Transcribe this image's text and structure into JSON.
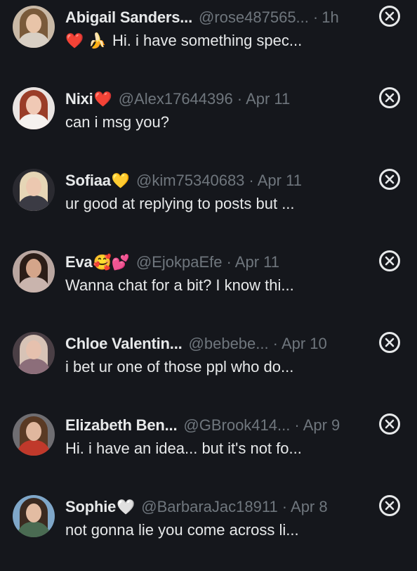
{
  "dismiss_icon": "close-circle-icon",
  "colors": {
    "background": "#15171c",
    "primary_text": "#e7e9ea",
    "secondary_text": "#6f767d"
  },
  "messages": [
    {
      "name": "Abigail Sanders...",
      "name_emoji": "",
      "handle": "@rose487565...",
      "separator": "·",
      "time": "1h",
      "lead_emoji": "❤️ 🍌",
      "preview": "Hi. i have something spec...",
      "avatar_colors": {
        "bg": "#c9b9a6",
        "hair": "#7a5a3a",
        "face": "#e8c4a8",
        "body": "#d8cfc4"
      }
    },
    {
      "name": "Nixi",
      "name_emoji": "❤️",
      "handle": "@Alex17644396",
      "separator": "·",
      "time": "Apr 11",
      "lead_emoji": "",
      "preview": "can i msg you?",
      "avatar_colors": {
        "bg": "#e9e4e2",
        "hair": "#9a3d28",
        "face": "#f0c9b5",
        "body": "#f5f1ee"
      }
    },
    {
      "name": "Sofiaa",
      "name_emoji": "💛",
      "handle": "@kim75340683",
      "separator": "·",
      "time": "Apr 11",
      "lead_emoji": "",
      "preview": "ur good at replying to posts but ...",
      "avatar_colors": {
        "bg": "#2a2a30",
        "hair": "#e6d6b6",
        "face": "#ecc8b0",
        "body": "#3b3b44"
      }
    },
    {
      "name": "Eva",
      "name_emoji": "🥰💕",
      "handle": "@EjokpaEfe",
      "separator": "·",
      "time": "Apr 11",
      "lead_emoji": "",
      "preview": "Wanna chat for a bit? I know thi...",
      "avatar_colors": {
        "bg": "#b9a6a0",
        "hair": "#2b1d17",
        "face": "#d4a58a",
        "body": "#c9b4ad"
      }
    },
    {
      "name": "Chloe Valentin...",
      "name_emoji": "",
      "handle": "@bebebe...",
      "separator": "·",
      "time": "Apr 10",
      "lead_emoji": "",
      "preview": "i bet ur one of those ppl who do...",
      "avatar_colors": {
        "bg": "#4a3f45",
        "hair": "#d7c3b6",
        "face": "#e6c1ae",
        "body": "#8c6e7a"
      }
    },
    {
      "name": "Elizabeth Ben...",
      "name_emoji": "",
      "handle": "@GBrook414...",
      "separator": "·",
      "time": "Apr 9",
      "lead_emoji": "",
      "preview": "Hi. i have an idea... but it's not fo...",
      "avatar_colors": {
        "bg": "#6f6e72",
        "hair": "#5a3a24",
        "face": "#e0b79e",
        "body": "#c0392b"
      }
    },
    {
      "name": "Sophie",
      "name_emoji": "🤍",
      "handle": "@BarbaraJac18911",
      "separator": "·",
      "time": "Apr 8",
      "lead_emoji": "",
      "preview": "not gonna lie you come across li...",
      "avatar_colors": {
        "bg": "#7fa7c9",
        "hair": "#3b2a20",
        "face": "#e3bca2",
        "body": "#4a6b52"
      }
    }
  ]
}
